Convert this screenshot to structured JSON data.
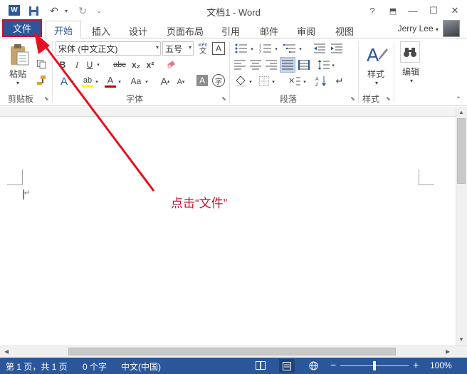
{
  "window": {
    "title": "文档1 - Word",
    "controls": {
      "help": "?",
      "ribbon_display": "⬒",
      "minimize": "—",
      "restore": "☐",
      "close": "✕"
    }
  },
  "quick_access": {
    "app_icon": "word-icon",
    "save": "save-icon",
    "undo": "undo-icon",
    "redo": "redo-icon",
    "customize": "customize-icon"
  },
  "tabs": [
    {
      "label": "文件",
      "name": "file"
    },
    {
      "label": "开始",
      "name": "home",
      "active": true
    },
    {
      "label": "插入",
      "name": "insert"
    },
    {
      "label": "设计",
      "name": "design"
    },
    {
      "label": "页面布局",
      "name": "layout"
    },
    {
      "label": "引用",
      "name": "references"
    },
    {
      "label": "邮件",
      "name": "mailings"
    },
    {
      "label": "审阅",
      "name": "review"
    },
    {
      "label": "视图",
      "name": "view"
    }
  ],
  "user": {
    "name": "Jerry Lee"
  },
  "ribbon": {
    "clipboard": {
      "label": "剪贴板",
      "paste_label": "粘贴"
    },
    "font": {
      "label": "字体",
      "font_name": "宋体 (中文正文)",
      "font_size": "五号",
      "bold": "B",
      "italic": "I",
      "underline": "U",
      "strike": "abc",
      "subscript": "x₂",
      "superscript": "x²",
      "color_letter": "A",
      "case": "Aa",
      "grow": "A",
      "shrink": "A",
      "wen_label": "wén",
      "wen_char": "文",
      "char_border": "A",
      "shade": "A",
      "circle_char": "字"
    },
    "paragraph": {
      "label": "段落"
    },
    "styles": {
      "label": "样式",
      "button_label": "样式"
    },
    "editing": {
      "button_label": "编辑"
    }
  },
  "annotation": {
    "text": "点击“文件”"
  },
  "status": {
    "page": "第 1 页，共 1 页",
    "words": "0 个字",
    "language": "中文(中国)",
    "zoom": "100%",
    "zoom_fraction": 0.5
  },
  "colors": {
    "brand": "#2b579a",
    "highlight": "#c3122d",
    "font_color": "#c00000",
    "highlighter": "#ffff00"
  }
}
